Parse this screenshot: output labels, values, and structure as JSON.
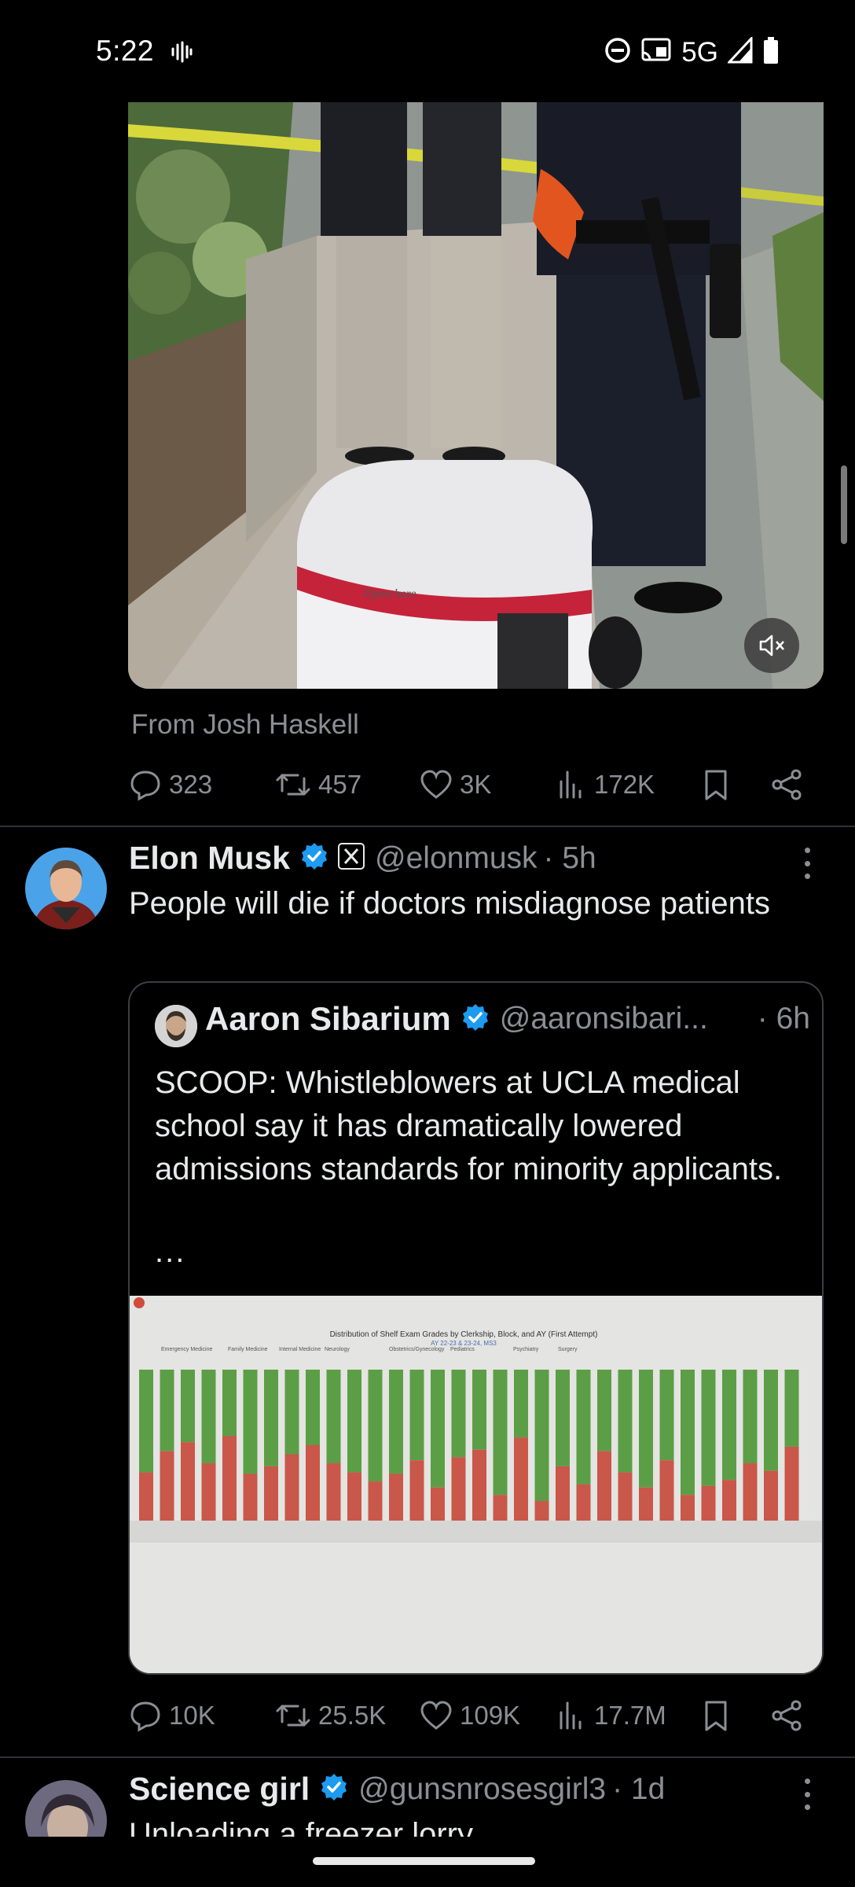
{
  "status": {
    "time": "5:22",
    "network": "5G"
  },
  "previous_tweet": {
    "media_source": "From Josh Haskell",
    "media_caption": "Open here",
    "stats": {
      "replies": "323",
      "retweets": "457",
      "likes": "3K",
      "views": "172K"
    }
  },
  "main_tweet": {
    "author": {
      "name": "Elon Musk",
      "handle": "@elonmusk",
      "time": "· 5h"
    },
    "text": "People will die if doctors misdiagnose patients",
    "quote": {
      "author": {
        "name": "Aaron Sibarium",
        "handle": "@aaronsibari...",
        "time": "· 6h"
      },
      "text": "SCOOP: Whistleblowers at UCLA medical school say it has dramatically lowered admissions standards for minority applicants.",
      "ellipsis": "...",
      "image": {
        "title": "Distribution of Shelf Exam Grades by Clerkship, Block, and AY (First Attempt)",
        "subtitle": "AY 22-23 & 23-24, MS3",
        "groups": [
          "Emergency Medicine",
          "Family Medicine",
          "Internal Medicine",
          "Neurology",
          "Obstetrics/Gynecology",
          "Pediatrics",
          "Psychiatry",
          "Surgery"
        ]
      }
    },
    "stats": {
      "replies": "10K",
      "retweets": "25.5K",
      "likes": "109K",
      "views": "17.7M"
    }
  },
  "next_tweet": {
    "author": {
      "name": "Science girl",
      "handle": "@gunsnrosesgirl3",
      "time": "· 1d"
    },
    "text": "Unloading a freezer lorry"
  },
  "colors": {
    "background": "#000000",
    "verified": "#1d9bf0",
    "muted_text": "#8b8f94",
    "chart_green": "#5c9e45",
    "chart_red": "#c9574a"
  }
}
